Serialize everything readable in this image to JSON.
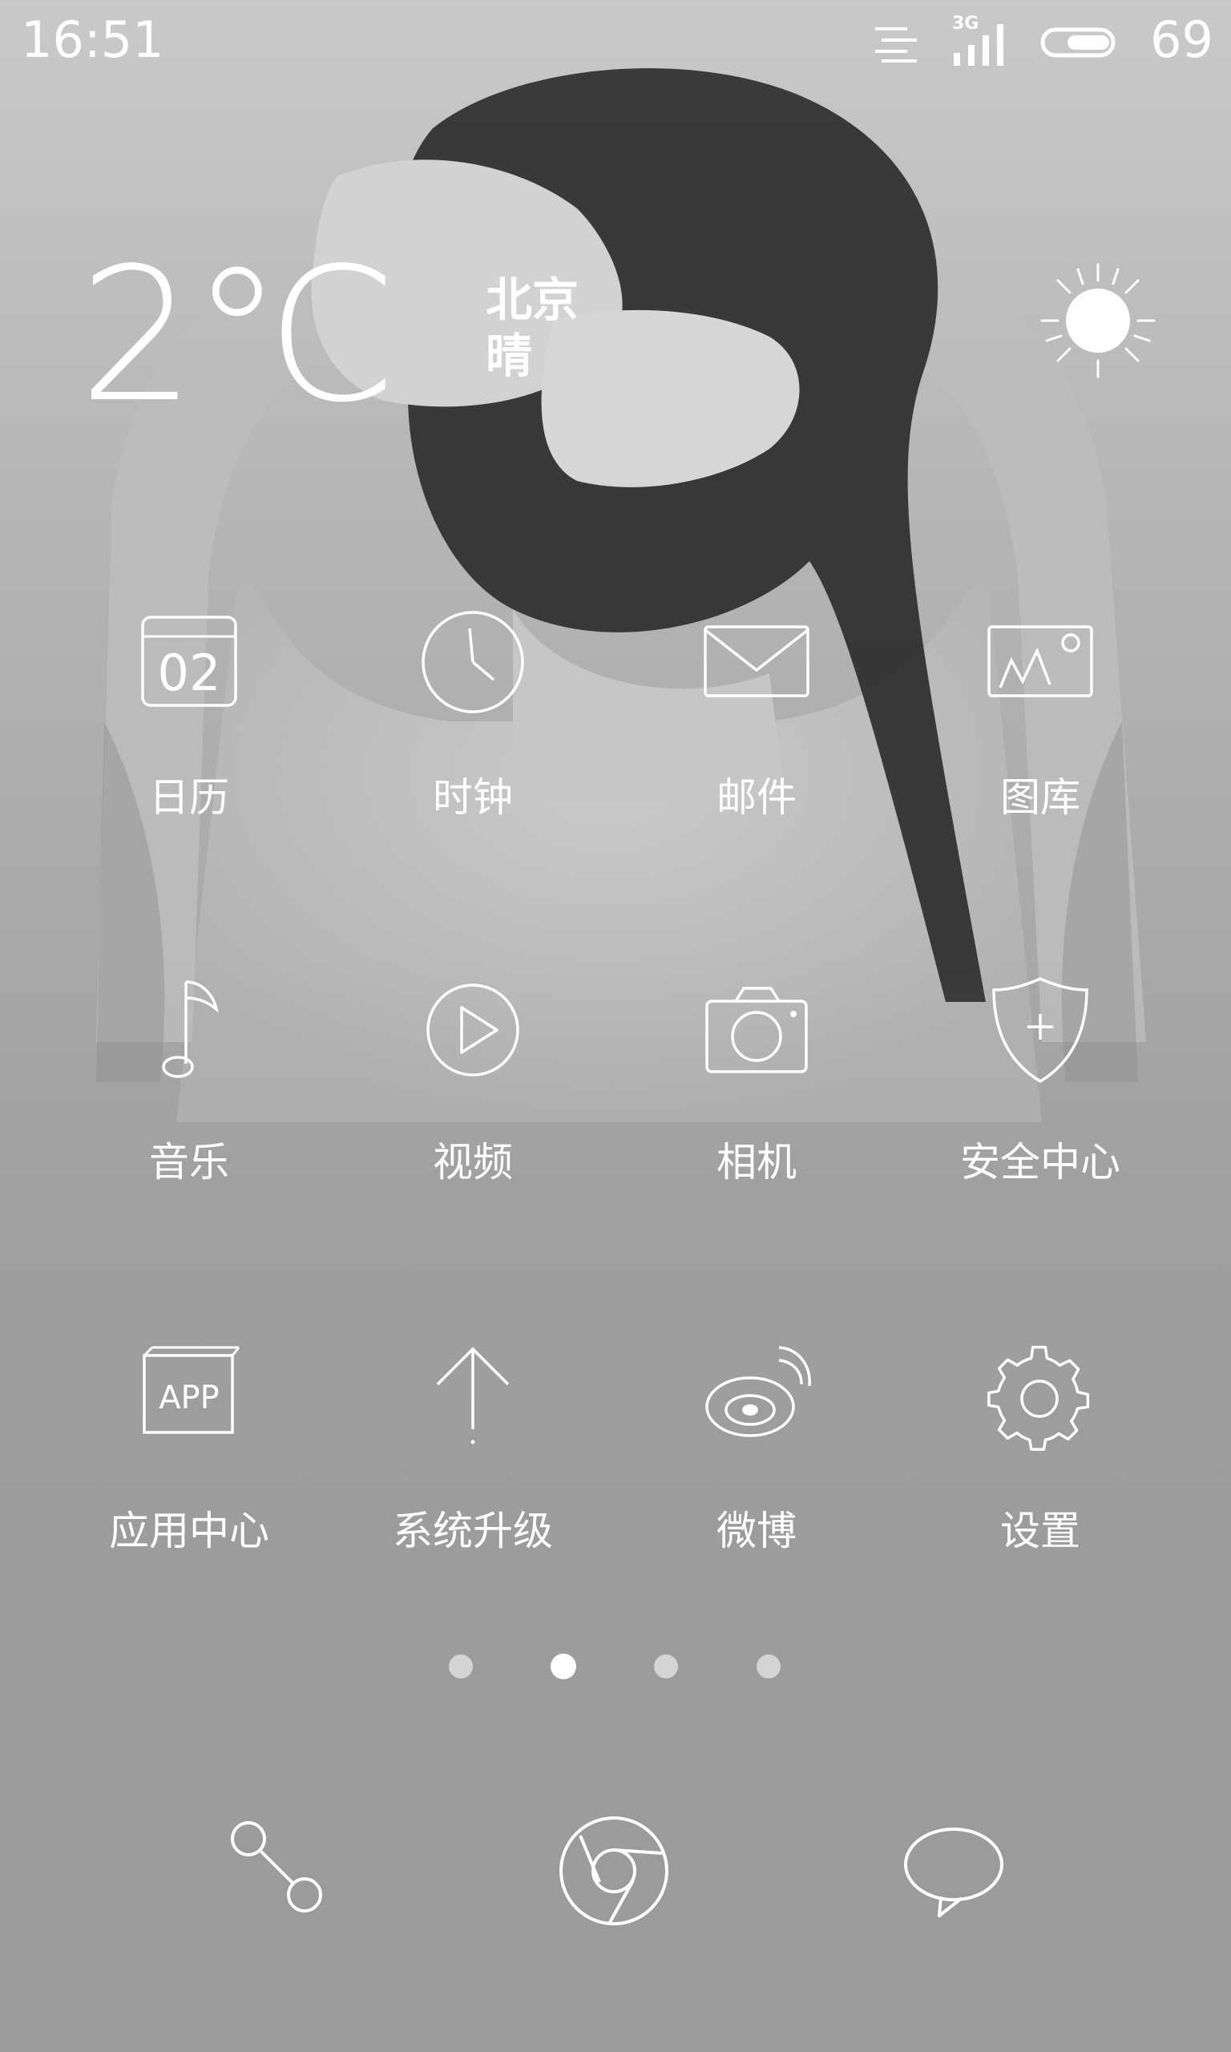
{
  "status_bar": {
    "time": "16:51",
    "network": "3G",
    "battery_level": "69"
  },
  "weather": {
    "temperature": "2℃",
    "city": "北京",
    "condition": "晴",
    "icon": "sun-icon"
  },
  "apps": [
    {
      "label": "日历",
      "icon": "calendar-icon",
      "date": "02"
    },
    {
      "label": "时钟",
      "icon": "clock-icon"
    },
    {
      "label": "邮件",
      "icon": "mail-icon"
    },
    {
      "label": "图库",
      "icon": "gallery-icon"
    },
    {
      "label": "音乐",
      "icon": "music-note-icon"
    },
    {
      "label": "视频",
      "icon": "play-icon"
    },
    {
      "label": "相机",
      "icon": "camera-icon"
    },
    {
      "label": "安全中心",
      "icon": "shield-plus-icon"
    },
    {
      "label": "应用中心",
      "icon": "app-store-icon",
      "icon_text": "APP"
    },
    {
      "label": "系统升级",
      "icon": "arrow-up-icon"
    },
    {
      "label": "微博",
      "icon": "weibo-icon"
    },
    {
      "label": "设置",
      "icon": "gear-icon"
    }
  ],
  "pager": {
    "pages": 4,
    "active": 2
  },
  "dock": [
    {
      "name": "phone",
      "icon": "phone-icon"
    },
    {
      "name": "browser",
      "icon": "browser-icon"
    },
    {
      "name": "messages",
      "icon": "message-bubble-icon"
    }
  ]
}
